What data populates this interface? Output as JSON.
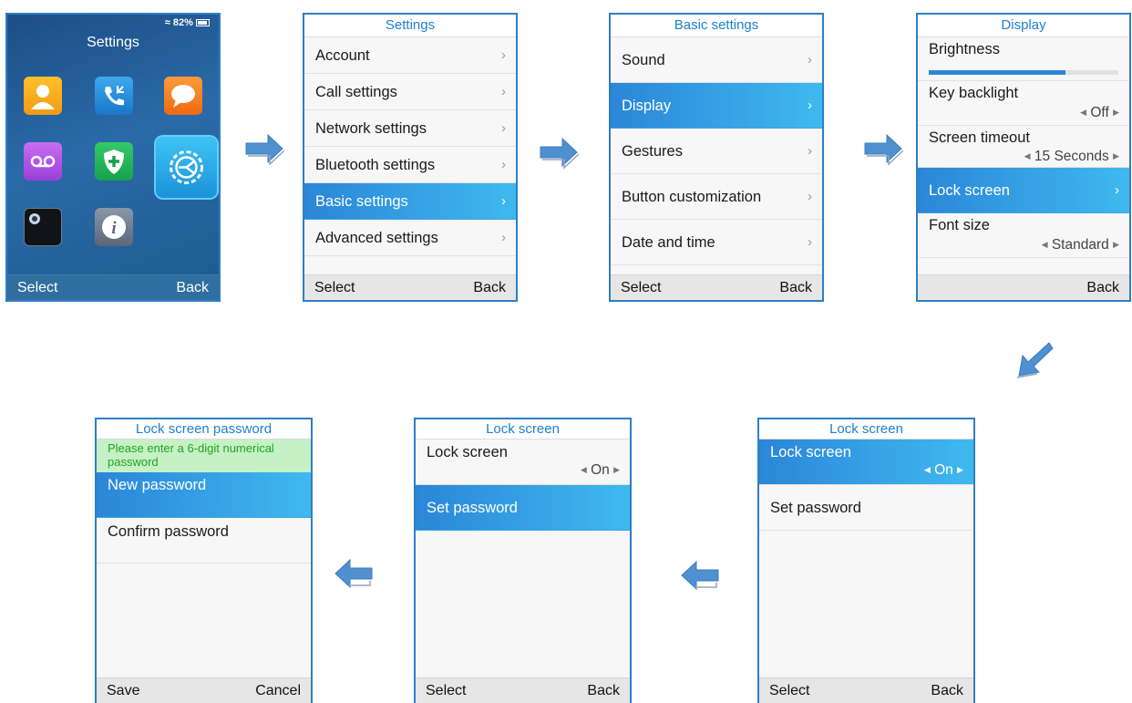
{
  "home": {
    "title": "Settings",
    "battery": "82%",
    "softkey_left": "Select",
    "softkey_right": "Back"
  },
  "settings": {
    "title": "Settings",
    "items": [
      "Account",
      "Call settings",
      "Network settings",
      "Bluetooth settings",
      "Basic settings",
      "Advanced settings"
    ],
    "softkey_left": "Select",
    "softkey_right": "Back"
  },
  "basic": {
    "title": "Basic settings",
    "items": [
      "Sound",
      "Display",
      "Gestures",
      "Button customization",
      "Date and time"
    ],
    "softkey_left": "Select",
    "softkey_right": "Back"
  },
  "display": {
    "title": "Display",
    "brightness_label": "Brightness",
    "brightness_level": 0.72,
    "key_backlight_label": "Key backlight",
    "key_backlight_value": "Off",
    "screen_timeout_label": "Screen timeout",
    "screen_timeout_value": "15 Seconds",
    "lock_screen_label": "Lock screen",
    "font_size_label": "Font size",
    "font_size_value": "Standard",
    "softkey_right": "Back"
  },
  "lock_a": {
    "title": "Lock screen",
    "lock_label": "Lock screen",
    "lock_value": "On",
    "set_password_label": "Set password",
    "softkey_left": "Select",
    "softkey_right": "Back"
  },
  "lock_b": {
    "title": "Lock screen",
    "lock_label": "Lock screen",
    "lock_value": "On",
    "set_password_label": "Set password",
    "softkey_left": "Select",
    "softkey_right": "Back"
  },
  "password": {
    "title": "Lock screen password",
    "hint": "Please enter a 6-digit numerical password",
    "new_label": "New password",
    "confirm_label": "Confirm password",
    "softkey_left": "Save",
    "softkey_right": "Cancel"
  },
  "colors": {
    "accent": "#2b86d8",
    "highlight_end": "#3fb9ef",
    "title_text": "#1f7fd0",
    "hint_bg": "#c6f0c6",
    "hint_text": "#1fa61f",
    "arrow": "#4f90d0"
  }
}
